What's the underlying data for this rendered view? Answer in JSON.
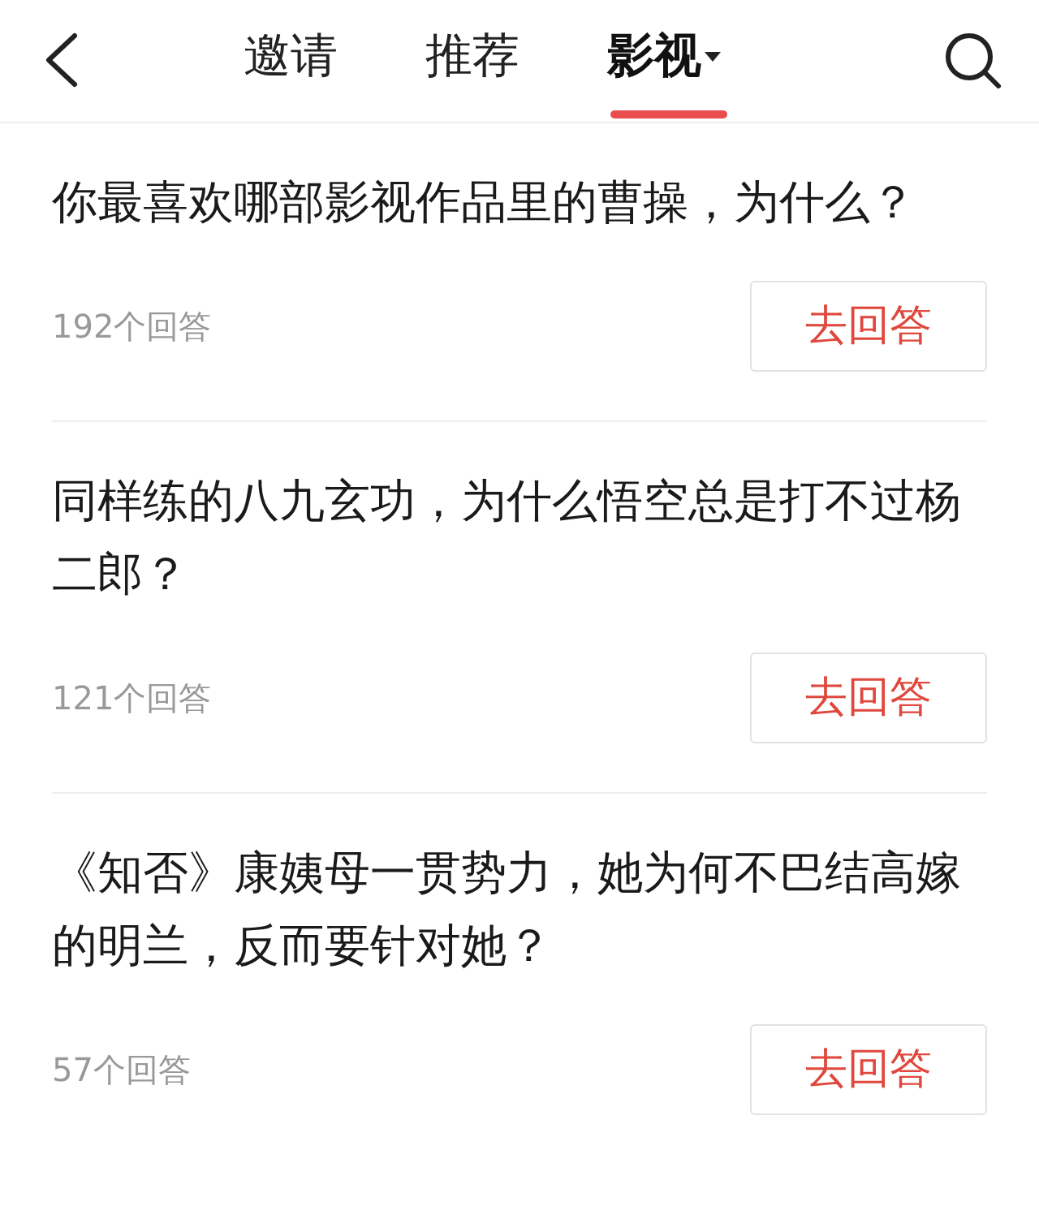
{
  "tabs": [
    {
      "label": "邀请",
      "selected": false,
      "dropdown": false
    },
    {
      "label": "推荐",
      "selected": false,
      "dropdown": false
    },
    {
      "label": "影视",
      "selected": true,
      "dropdown": true
    }
  ],
  "questions": [
    {
      "title": "你最喜欢哪部影视作品里的曹操，为什么？",
      "count": "192个回答",
      "button": "去回答"
    },
    {
      "title": "同样练的八九玄功，为什么悟空总是打不过杨二郎？",
      "count": "121个回答",
      "button": "去回答"
    },
    {
      "title": "《知否》康姨母一贯势力，她为何不巴结高嫁的明兰，反而要针对她？",
      "count": "57个回答",
      "button": "去回答"
    }
  ]
}
